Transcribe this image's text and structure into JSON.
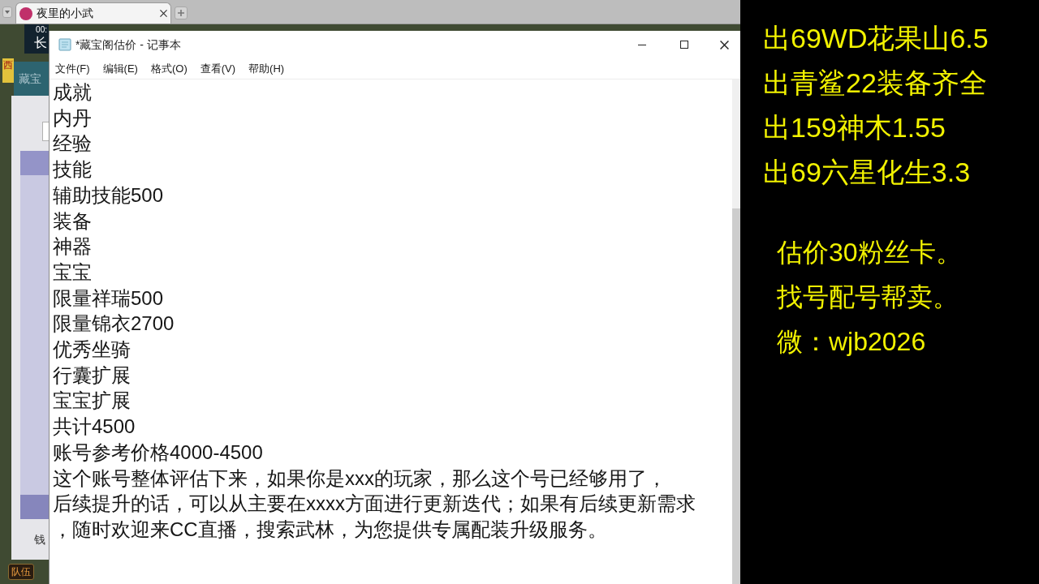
{
  "browser": {
    "tabs": [
      {
        "title": "夜里的小武",
        "selected": true
      }
    ]
  },
  "game": {
    "top_text": "00:",
    "badge": "长",
    "sign": "西",
    "panel_title": "藏宝",
    "side_label": "钱",
    "team_button": "队伍"
  },
  "notepad": {
    "title": "*藏宝阁估价 - 记事本",
    "menu": [
      "文件(F)",
      "编辑(E)",
      "格式(O)",
      "查看(V)",
      "帮助(H)"
    ],
    "lines": [
      "成就",
      "内丹",
      "经验",
      "技能",
      "辅助技能500",
      "装备",
      "神器",
      "宝宝",
      "限量祥瑞500",
      "限量锦衣2700",
      "优秀坐骑",
      "行囊扩展",
      "宝宝扩展",
      "共计4500",
      "账号参考价格4000-4500",
      "这个账号整体评估下来，如果你是xxx的玩家，那么这个号已经够用了，",
      "后续提升的话，可以从主要在xxxx方面进行更新迭代；如果有后续更新需求",
      "，随时欢迎来CC直播，搜索武林，为您提供专属配装升级服务。"
    ]
  },
  "overlay": {
    "listings": [
      "出69WD花果山6.5",
      "出青鲨22装备齐全",
      "出159神木1.55",
      "出69六星化生3.3"
    ],
    "notes": [
      "估价30粉丝卡。",
      "找号配号帮卖。",
      "微：wjb2026"
    ]
  }
}
